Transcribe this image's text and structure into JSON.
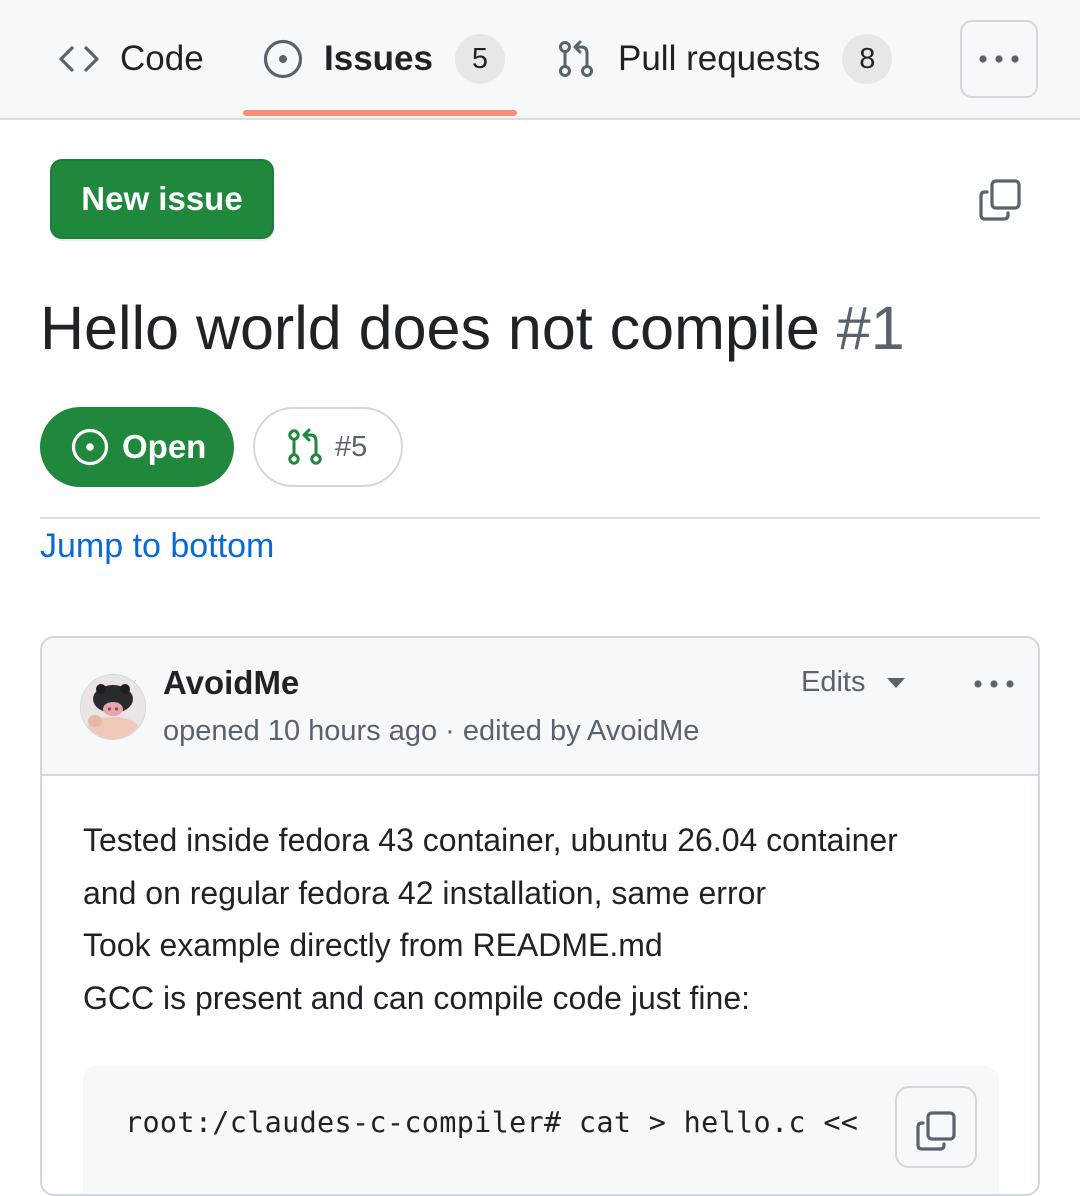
{
  "tabs": {
    "code_label": "Code",
    "issues_label": "Issues",
    "issues_count": "5",
    "pulls_label": "Pull requests",
    "pulls_count": "8",
    "active": "issues"
  },
  "actions": {
    "new_issue_label": "New issue"
  },
  "issue": {
    "title": "Hello world does not compile",
    "number": "#1",
    "state": "Open",
    "linked_pr": "#5",
    "jump_label": "Jump to bottom"
  },
  "comment": {
    "author": "AvoidMe",
    "meta": "opened 10 hours ago · edited by AvoidMe",
    "edits_label": "Edits",
    "body_lines": [
      "Tested inside fedora 43 container, ubuntu 26.04 container",
      "and on regular fedora 42 installation, same error",
      "Took example directly from README.md",
      "GCC is present and can compile code just fine:"
    ],
    "code": "root:/claudes-c-compiler# cat > hello.c <<"
  },
  "colors": {
    "accent_green": "#1f883d",
    "tab_underline": "#fd8c73",
    "link_blue": "#0969da",
    "muted_text": "#59636e"
  },
  "icons": [
    "code-icon",
    "issue-opened-icon",
    "git-pull-request-icon",
    "kebab-horizontal-icon",
    "copy-icon",
    "triangle-down-icon"
  ]
}
